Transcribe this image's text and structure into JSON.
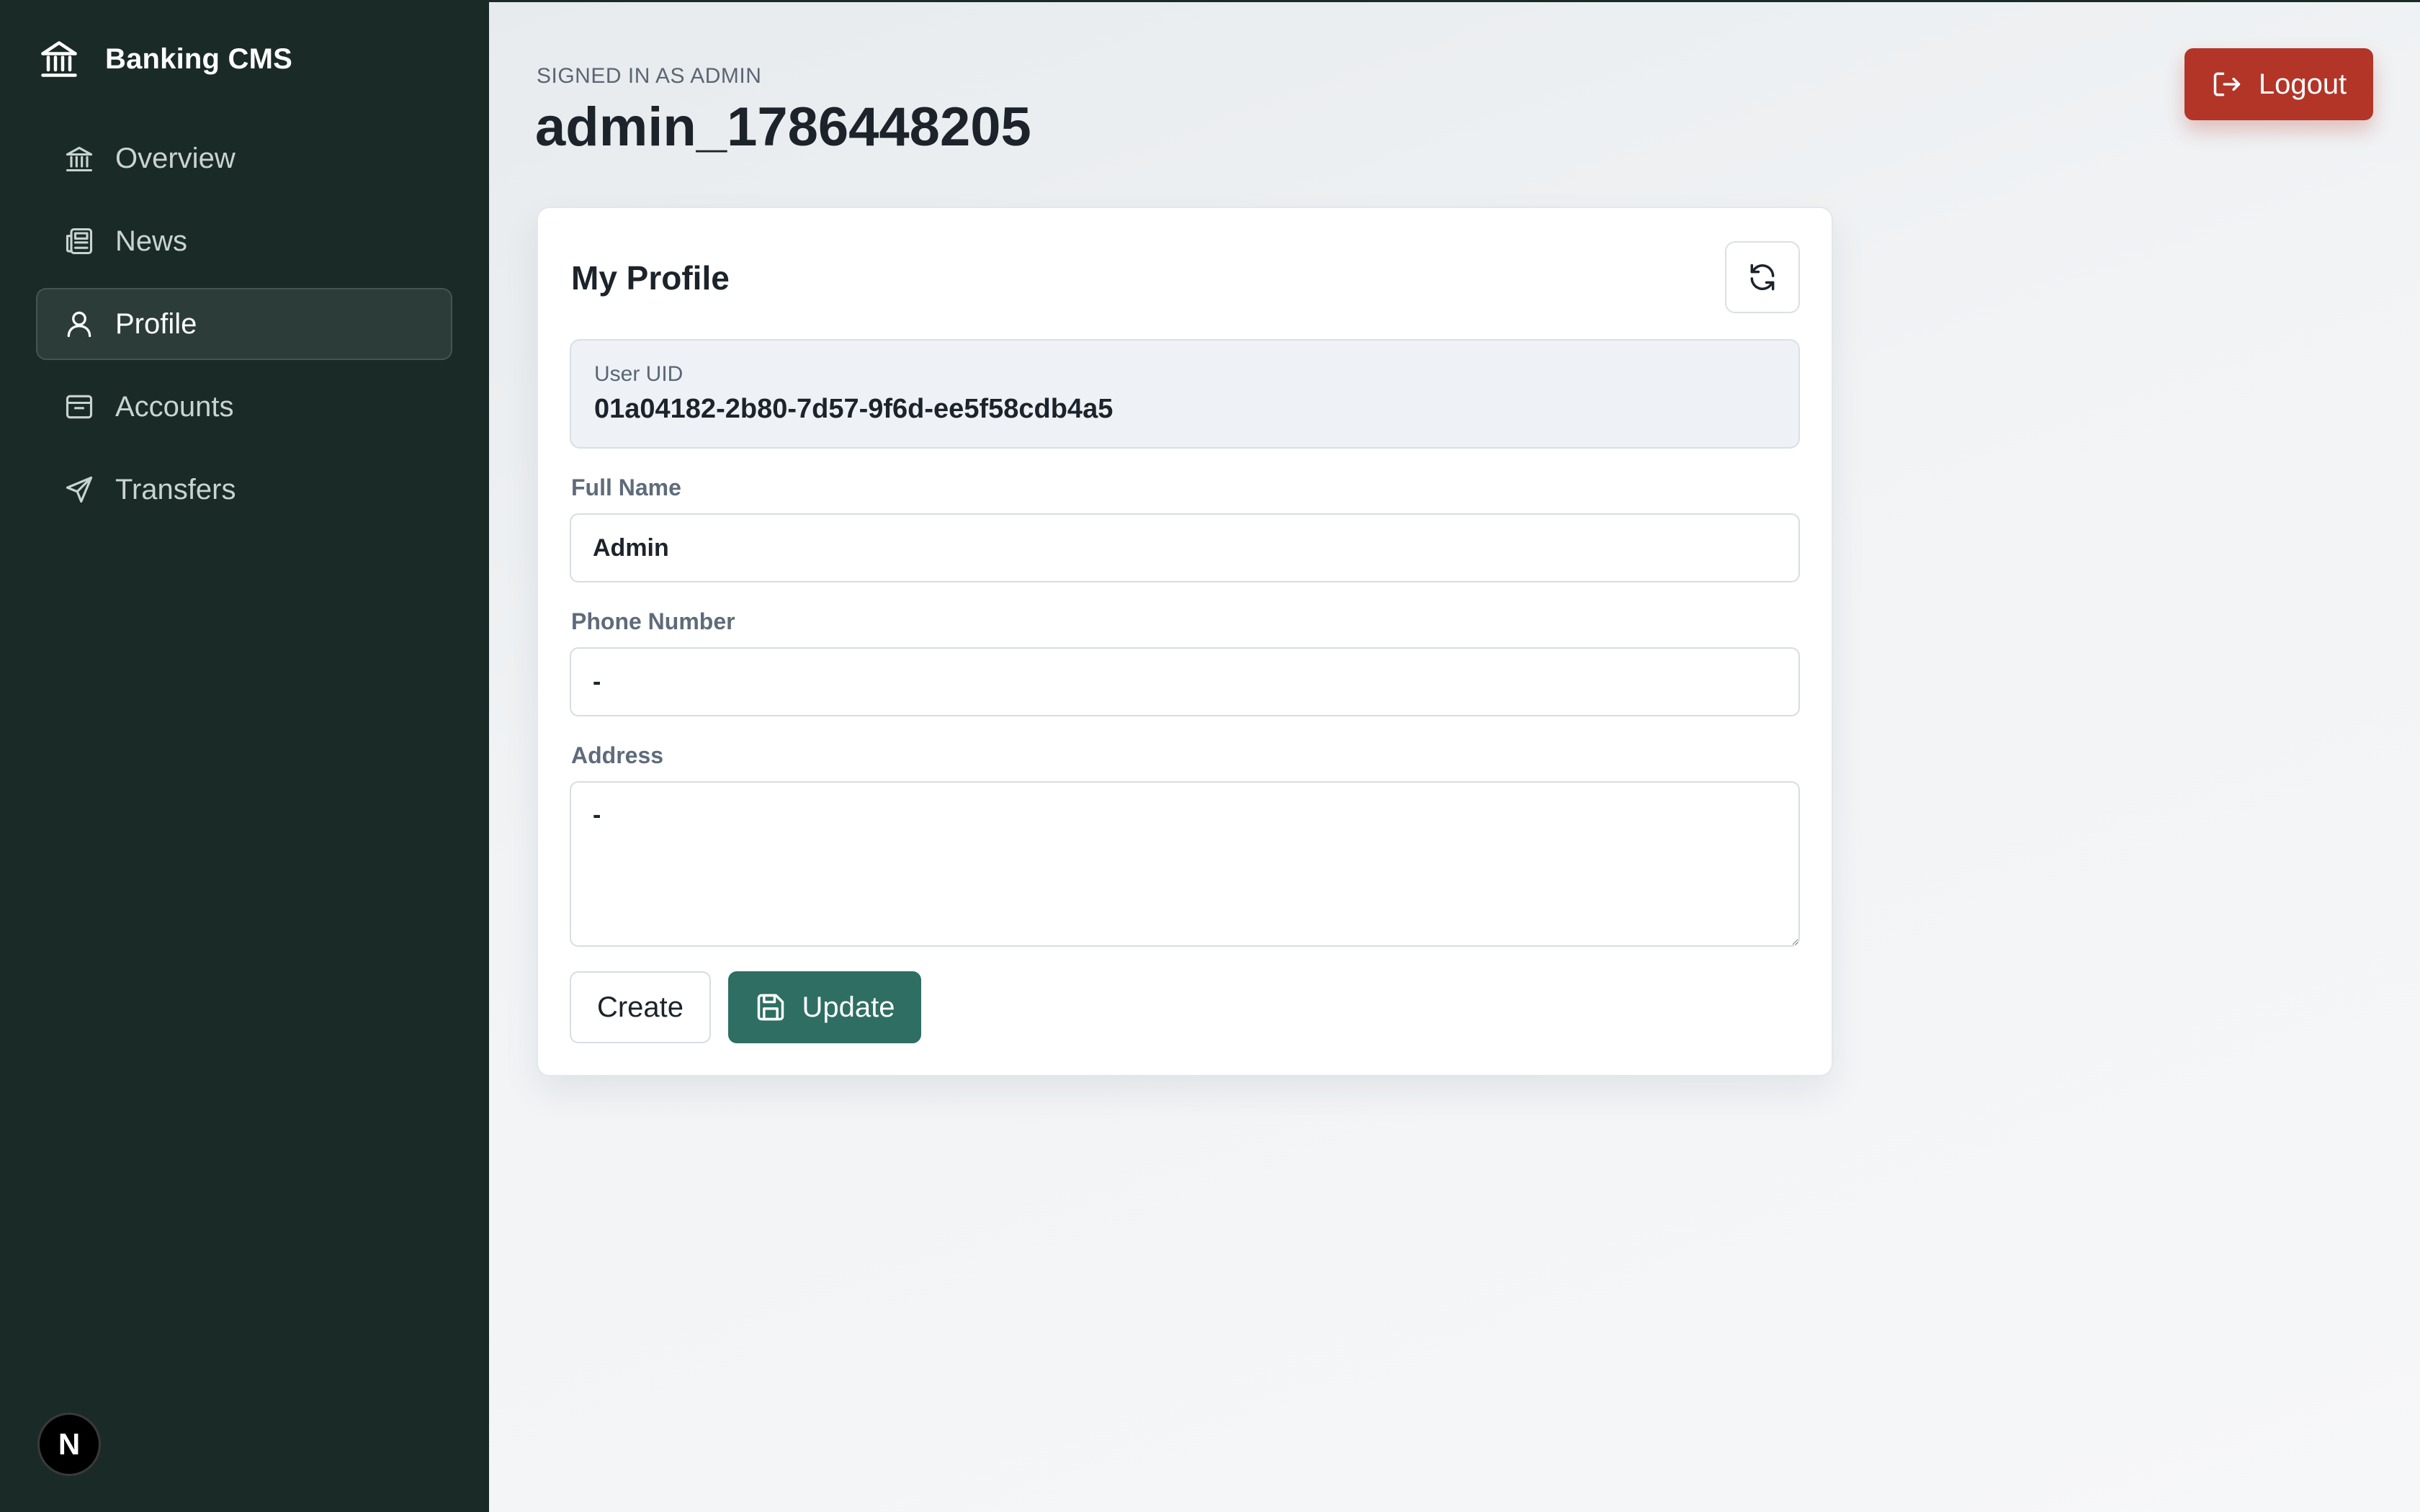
{
  "sidebar": {
    "brand": {
      "title": "Banking CMS",
      "icon": "bank-icon"
    },
    "items": [
      {
        "label": "Overview",
        "icon": "bank-icon",
        "active": false
      },
      {
        "label": "News",
        "icon": "newspaper-icon",
        "active": false
      },
      {
        "label": "Profile",
        "icon": "user-icon",
        "active": true
      },
      {
        "label": "Accounts",
        "icon": "archive-icon",
        "active": false
      },
      {
        "label": "Transfers",
        "icon": "send-icon",
        "active": false
      }
    ],
    "avatar_letter": "N"
  },
  "header": {
    "signed_in": "SIGNED IN AS ADMIN",
    "username": "admin_1786448205",
    "logout_label": "Logout"
  },
  "profile": {
    "title": "My Profile",
    "uid_label": "User UID",
    "uid_value": "01a04182-2b80-7d57-9f6d-ee5f58cdb4a5",
    "full_name_label": "Full Name",
    "full_name_value": "Admin",
    "phone_label": "Phone Number",
    "phone_value": "-",
    "address_label": "Address",
    "address_value": "-",
    "create_label": "Create",
    "update_label": "Update"
  },
  "colors": {
    "sidebar_bg": "#1a2a27",
    "logout_red": "#b23528",
    "update_green": "#2e6e63"
  }
}
